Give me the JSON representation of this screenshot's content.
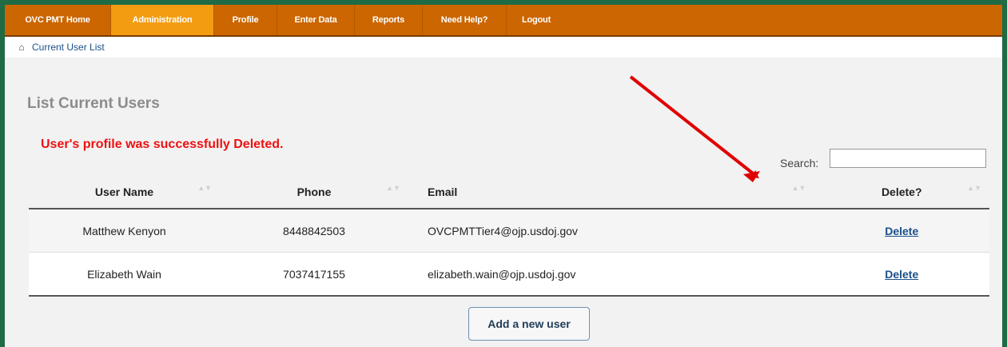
{
  "nav": {
    "items": [
      {
        "label": "OVC PMT Home",
        "active": false
      },
      {
        "label": "Administration",
        "active": true
      },
      {
        "label": "Profile",
        "active": false
      },
      {
        "label": "Enter Data",
        "active": false
      },
      {
        "label": "Reports",
        "active": false
      },
      {
        "label": "Need Help?",
        "active": false
      },
      {
        "label": "Logout",
        "active": false
      }
    ]
  },
  "breadcrumb": {
    "icon": "home-icon",
    "label": "Current User List"
  },
  "page": {
    "title": "List Current Users",
    "message": "User's profile was successfully Deleted."
  },
  "search": {
    "label": "Search:",
    "value": ""
  },
  "table": {
    "headers": [
      "User Name",
      "Phone",
      "Email",
      "Delete?"
    ],
    "rows": [
      {
        "name": "Matthew Kenyon",
        "phone": "8448842503",
        "email": "OVCPMTTier4@ojp.usdoj.gov",
        "action": "Delete"
      },
      {
        "name": "Elizabeth Wain",
        "phone": "7037417155",
        "email": "elizabeth.wain@ojp.usdoj.gov",
        "action": "Delete"
      }
    ]
  },
  "add_button": {
    "label": "Add a new user"
  },
  "colors": {
    "nav_bg": "#cc6600",
    "nav_active": "#f39c12",
    "frame": "#1f6b45",
    "message": "#ee1111",
    "annotation_arrow": "#e00000"
  }
}
